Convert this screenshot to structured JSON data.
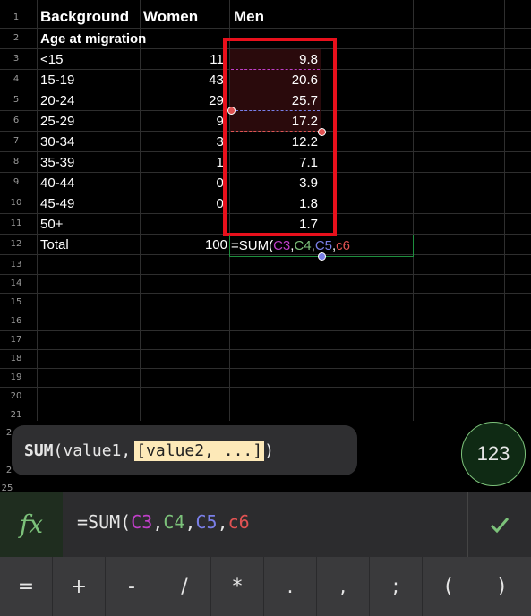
{
  "headers": {
    "a": "Background",
    "b": "Women",
    "c": "Men"
  },
  "row_numbers": [
    "1",
    "2",
    "3",
    "4",
    "5",
    "6",
    "7",
    "8",
    "9",
    "10",
    "11",
    "12",
    "13",
    "14",
    "15",
    "16",
    "17",
    "18",
    "19",
    "20",
    "21"
  ],
  "rows": [
    {
      "a": "Age at migration",
      "b": "",
      "c": ""
    },
    {
      "a": "<15",
      "b": "11.",
      "c": "9.8"
    },
    {
      "a": "15-19",
      "b": "43.",
      "c": "20.6"
    },
    {
      "a": "20-24",
      "b": "29.",
      "c": "25.7"
    },
    {
      "a": "25-29",
      "b": "9.",
      "c": "17.2"
    },
    {
      "a": "30-34",
      "b": "3.",
      "c": "12.2"
    },
    {
      "a": "35-39",
      "b": "1.",
      "c": "7.1"
    },
    {
      "a": "40-44",
      "b": "0.",
      "c": "3.9"
    },
    {
      "a": "45-49",
      "b": "0.",
      "c": "1.8"
    },
    {
      "a": "50+",
      "b": "",
      "c": "1.7"
    },
    {
      "a": "Total",
      "b": "100",
      "c": ""
    }
  ],
  "active_cell": {
    "prefix": "=SUM(",
    "r1": "C3",
    "r2": "C4",
    "r3": "C5",
    "r4": "c6",
    "sep": ","
  },
  "tooltip": {
    "func": "SUM",
    "open": "(",
    "arg1": "value1, ",
    "arg2": "[value2, ...]",
    "close": ")"
  },
  "keyboard_toggle": "123",
  "partial_rows": {
    "r22": "2",
    "r23": "2",
    "r24": "2",
    "r25": "25"
  },
  "formula_bar": {
    "fx": "fx",
    "prefix": "=SUM(",
    "r1": "C3",
    "r2": "C4",
    "r3": "C5",
    "r4": "c6",
    "sep": ","
  },
  "confirm_icon": "check-icon",
  "keys": [
    "=",
    "+",
    "-",
    "/",
    "*",
    ".",
    ",",
    ";",
    "(",
    ")"
  ],
  "colors": {
    "ref1": "#c03fc9",
    "ref2": "#7cc27a",
    "ref3": "#7a7fe8",
    "ref4": "#e05252",
    "selection": "#e8101c",
    "accent": "#1e8e3e"
  }
}
